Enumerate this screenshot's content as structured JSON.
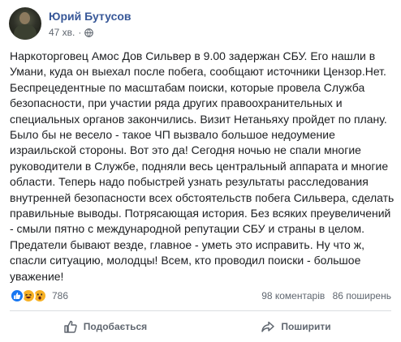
{
  "post": {
    "author": "Юрий Бутусов",
    "time": "47 хв.",
    "text_lines": [
      "Наркоторговец Амос Дов Сильвер в 9.00 задержан СБУ. Его нашли в",
      "Умани, куда он выехал после побега, сообщают источники Цензор.Нет.",
      "Беспрецедентные по масштабам поиски, которые провела Служба",
      "безопасности, при участии ряда других правоохранительных и",
      "специальных органов закончились. Визит Нетаньяху пройдет по плану.",
      "Было бы не весело - такое ЧП вызвало большое недоумение",
      "израильской стороны. Вот это да! Сегодня ночью не спали многие",
      "руководители в Службе, подняли весь центральный аппарата и многие",
      "области. Теперь надо побыстрей узнать результаты расследования",
      "внутренней безопасности всех обстоятельств побега Сильвера, сделать",
      "правильные выводы. Потрясающая история. Без всяких преувеличений",
      "- смыли пятно с международной репутации СБУ и страны в целом.",
      "Предатели бывают везде, главное - уметь это исправить. Ну что ж,",
      "спасли ситуацию, молодцы! Всем, кто проводил поиски - большое",
      "уважение!"
    ]
  },
  "stats": {
    "reactions_count": "786",
    "comments": "98 коментарів",
    "shares": "86 поширень"
  },
  "actions": {
    "like_label": "Подобається",
    "share_label": "Поширити"
  },
  "icons": {
    "privacy": "globe-icon",
    "reactions": [
      "like-reaction-icon",
      "haha-reaction-icon",
      "wow-reaction-icon"
    ],
    "like": "thumbs-up-icon",
    "share": "share-arrow-icon"
  },
  "colors": {
    "author": "#385898",
    "like_reaction": "#1877f2",
    "emoji_reaction": "#f7b125",
    "muted_text": "#606770"
  }
}
